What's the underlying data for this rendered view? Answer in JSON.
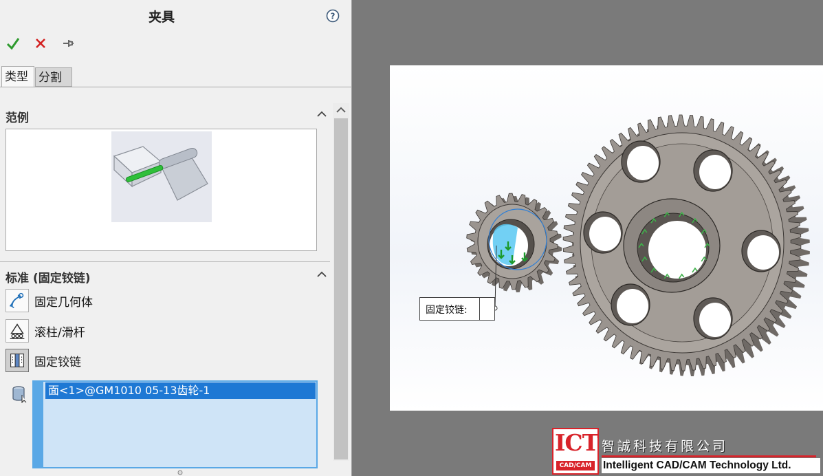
{
  "panel": {
    "title": "夹具",
    "tabs": [
      {
        "label": "类型",
        "active": true
      },
      {
        "label": "分割",
        "active": false
      }
    ],
    "sections": {
      "example": {
        "title": "范例"
      },
      "standard": {
        "title": "标准 (固定铰链)"
      }
    },
    "fixture_options": [
      {
        "label": "固定几何体",
        "icon": "anchor-icon",
        "selected": false
      },
      {
        "label": "滚柱/滑杆",
        "icon": "roller-icon",
        "selected": false
      },
      {
        "label": "固定铰链",
        "icon": "hinge-icon",
        "selected": true
      }
    ],
    "selected_entity": "面<1>@GM1010 05-13齿轮-1"
  },
  "viewport": {
    "callout_label": "固定铰链:"
  },
  "logo": {
    "mark": "ICT",
    "badge": "CAD/CAM",
    "chinese_name": "智誠科技有限公司",
    "english_name": "Intelligent CAD/CAM Technology Ltd."
  },
  "colors": {
    "selection_highlight": "#1e78d4",
    "selection_box": "#cfe4f7",
    "ok_green": "#2e9a2e",
    "cancel_red": "#d32020",
    "brand_red": "#d8232a",
    "gear_gray": "#9a948f"
  }
}
